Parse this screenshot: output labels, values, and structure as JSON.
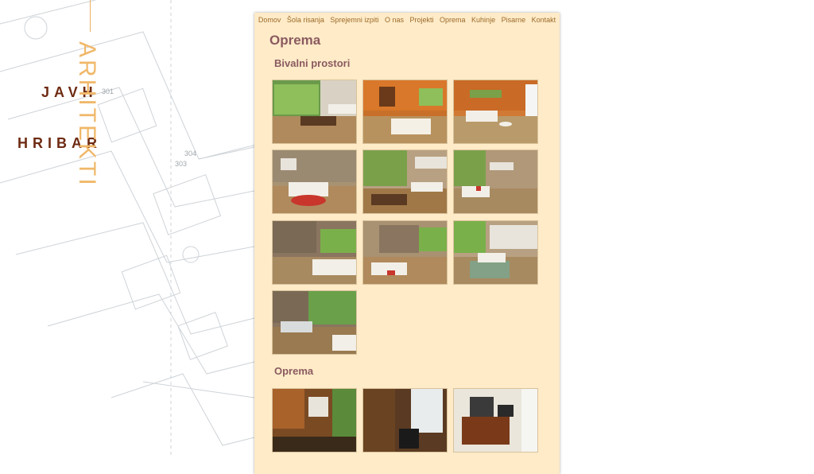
{
  "brand": {
    "line1": "JAVH",
    "line2": "HRIBAR",
    "vertical": "ARHITEKTI"
  },
  "nav": {
    "items": [
      "Domov",
      "Šola risanja",
      "Sprejemni izpiti",
      "O nas",
      "Projekti",
      "Oprema",
      "Kuhinje",
      "Pisarne",
      "Kontakt"
    ]
  },
  "page": {
    "title": "Oprema"
  },
  "sections": [
    {
      "title": "Bivalni prostori",
      "count": 10
    },
    {
      "title": "Oprema",
      "count": 3
    }
  ],
  "colors": {
    "panel_bg": "#ffebc8",
    "heading": "#8a5a60",
    "brand_dark": "#6e2a12",
    "brand_accent": "#f0b86a",
    "nav_link": "#9b6a2a"
  }
}
